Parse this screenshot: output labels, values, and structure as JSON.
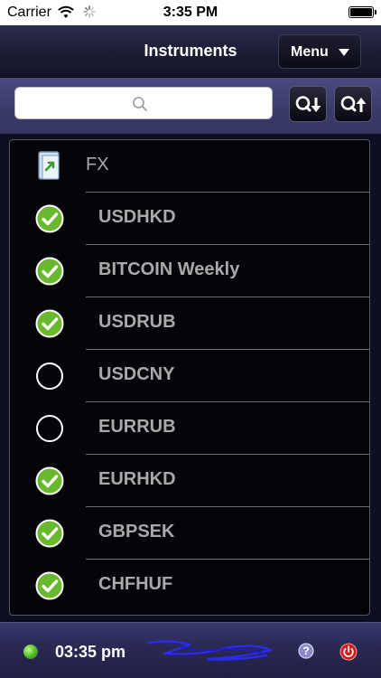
{
  "status_bar": {
    "carrier": "Carrier",
    "time": "3:35 PM"
  },
  "nav": {
    "title": "Instruments",
    "menu_label": "Menu"
  },
  "search": {
    "placeholder": "",
    "value": ""
  },
  "list": {
    "group_label": "FX",
    "items": [
      {
        "label": "USDHKD",
        "checked": true
      },
      {
        "label": "BITCOIN Weekly",
        "checked": true
      },
      {
        "label": "USDRUB",
        "checked": true
      },
      {
        "label": "USDCNY",
        "checked": false
      },
      {
        "label": "EURRUB",
        "checked": false
      },
      {
        "label": "EURHKD",
        "checked": true
      },
      {
        "label": "GBPSEK",
        "checked": true
      },
      {
        "label": "CHFHUF",
        "checked": true
      }
    ]
  },
  "bottom_bar": {
    "clock": "03:35 pm",
    "connection_color": "#4fb52a"
  },
  "colors": {
    "check_green": "#6ab82e",
    "nav_bg": "#1c1c35",
    "search_bar_bg": "#3c3c6c"
  }
}
